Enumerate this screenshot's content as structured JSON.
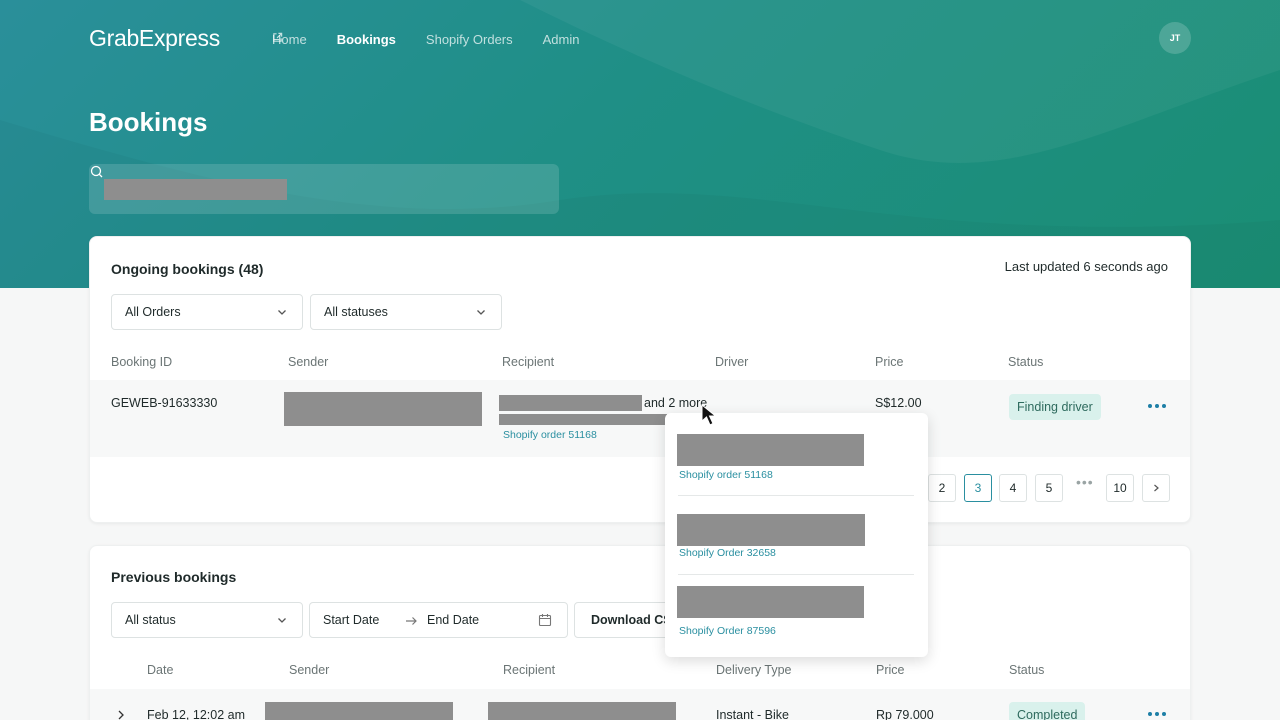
{
  "header": {
    "logo": "GrabExpress",
    "nav": [
      {
        "label": "Home"
      },
      {
        "label": "Bookings"
      },
      {
        "label": "Shopify Orders"
      },
      {
        "label": "Admin"
      }
    ],
    "avatar_initials": "JT"
  },
  "page_title": "Bookings",
  "ongoing": {
    "title": "Ongoing bookings (48)",
    "last_updated": "Last updated 6 seconds ago",
    "filter_orders": "All Orders",
    "filter_statuses": "All statuses",
    "columns": [
      "Booking ID",
      "Sender",
      "Recipient",
      "Driver",
      "Price",
      "Status"
    ],
    "row": {
      "booking_id": "GEWEB-91633330",
      "recipient_more": "and 2 more",
      "shopify_order": "Shopify order 51168",
      "price": "S$12.00",
      "status": "Finding driver"
    },
    "pagination": [
      "2",
      "3",
      "4",
      "5",
      "10"
    ],
    "pagination_active": "3"
  },
  "recipients_popover": {
    "items": [
      {
        "order": "Shopify order 51168"
      },
      {
        "order": "Shopify Order 32658"
      },
      {
        "order": "Shopify Order 87596"
      }
    ]
  },
  "previous": {
    "title": "Previous bookings",
    "filter_status": "All status",
    "start_date": "Start Date",
    "end_date": "End Date",
    "download": "Download CS",
    "columns": [
      "Date",
      "Sender",
      "Recipient",
      "Delivery Type",
      "Price",
      "Status"
    ],
    "row": {
      "date": "Feb 12, 12:02 am",
      "delivery_type": "Instant - Bike",
      "price": "Rp 79.000",
      "status": "Completed"
    }
  },
  "colors": {
    "accent": "#2a8fa0",
    "hero_start": "#2a8f9a",
    "hero_end": "#1a8e74",
    "badge_bg": "#d9f1ec"
  }
}
